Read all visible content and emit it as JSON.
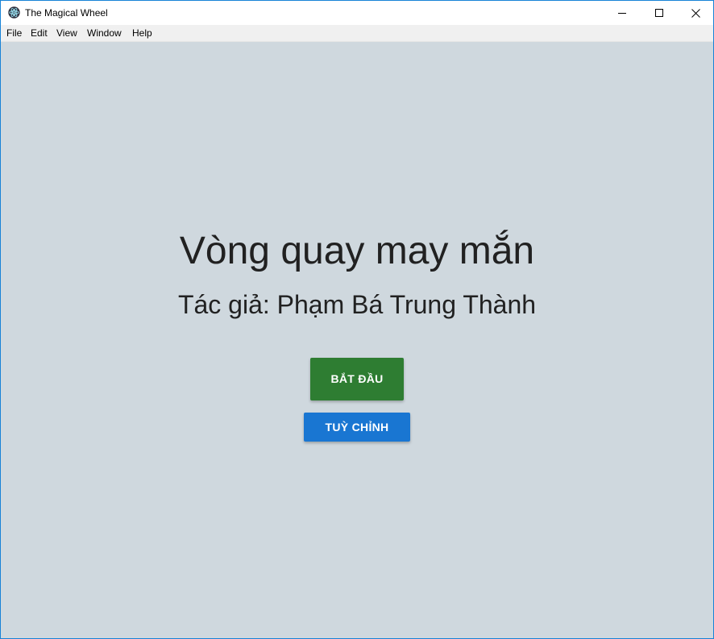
{
  "window": {
    "title": "The Magical Wheel",
    "icon": "electron-atom-icon",
    "controls": [
      "minimize-icon",
      "maximize-icon",
      "close-icon"
    ]
  },
  "menubar": {
    "items": [
      "File",
      "Edit",
      "View",
      "Window",
      "Help"
    ]
  },
  "main": {
    "title": "Vòng quay may mắn",
    "subtitle": "Tác giả: Phạm Bá Trung Thành",
    "start_button": "BẮT ĐẦU",
    "custom_button": "TUỲ CHỈNH"
  },
  "colors": {
    "background": "#cfd8de",
    "start_button": "#2e7d32",
    "custom_button": "#1976d2",
    "window_border": "#1883d7"
  }
}
